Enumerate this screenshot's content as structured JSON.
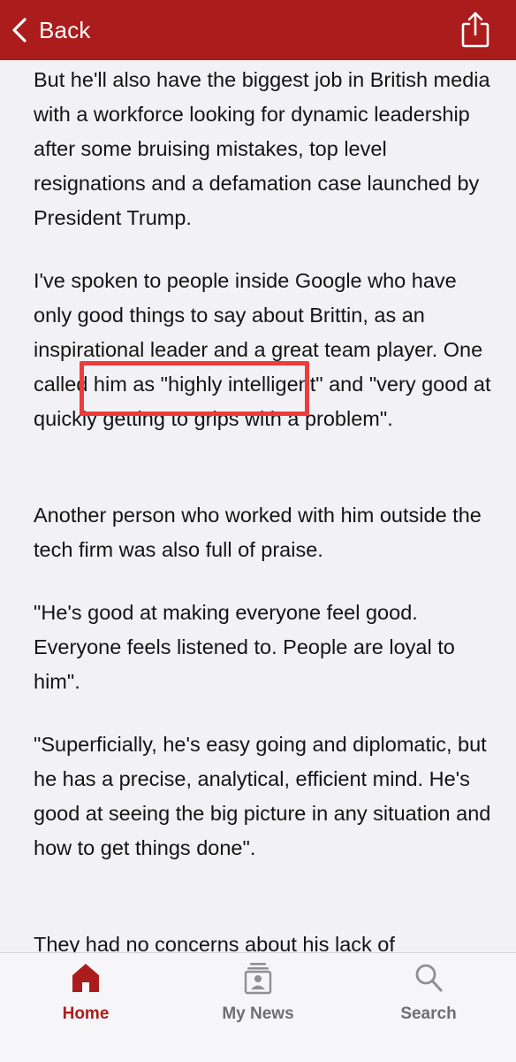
{
  "header": {
    "back_label": "Back",
    "back_icon": "chevron-left-icon",
    "share_icon": "share-icon",
    "bg_color": "#ab1c1c"
  },
  "article": {
    "paragraphs": [
      "But he'll also have the biggest job in British media with a workforce looking for dynamic leadership after some bruising mistakes, top level resignations and a defamation case launched by President Trump.",
      "I've spoken to people inside Google who have only good things to say about Brittin, as an inspirational leader and a great team player. One called him as \"highly intelligent\" and \"very good at quickly getting to grips with a problem\".",
      "Another person who worked with him outside the tech firm was also full of praise.",
      "\"He's good at making everyone feel good. Everyone feels listened to. People are loyal to him\".",
      "\"Superficially, he's easy going and diplomatic, but he has a precise, analytical, efficient mind. He's good at seeing the big picture in any situation and how to get things done\".",
      "They had no concerns about his lack of"
    ],
    "highlight_color": "#ee3b3b"
  },
  "tabbar": {
    "tabs": [
      {
        "label": "Home",
        "icon": "home-icon",
        "active": true
      },
      {
        "label": "My News",
        "icon": "my-news-icon",
        "active": false
      },
      {
        "label": "Search",
        "icon": "search-icon",
        "active": false
      }
    ],
    "active_color": "#ab1c1c",
    "inactive_color": "#6e6e73"
  }
}
